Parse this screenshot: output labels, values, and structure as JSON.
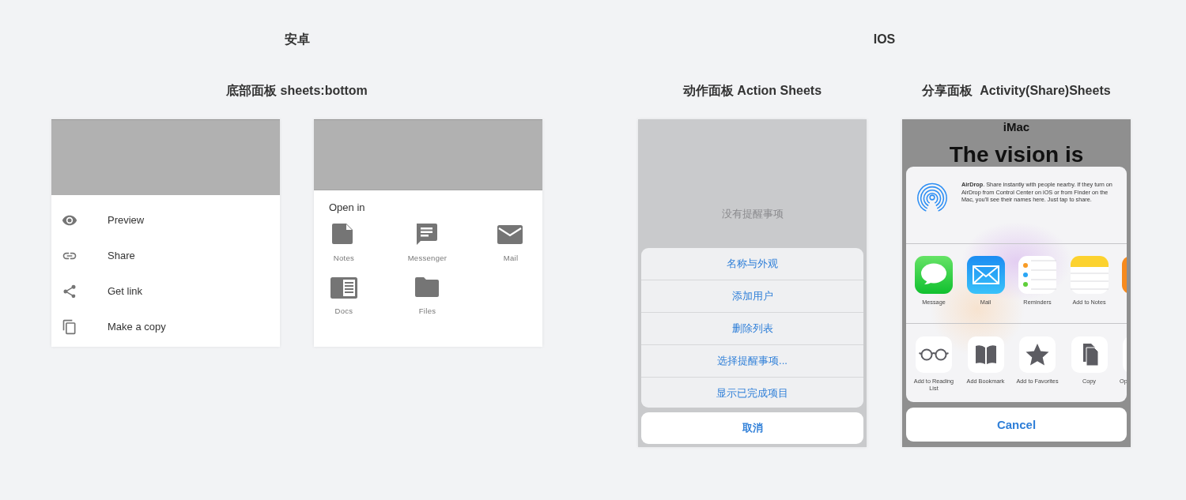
{
  "android": {
    "title": "安卓",
    "subtitle": "底部面板 sheets:bottom",
    "list_sheet": {
      "items": [
        {
          "label": "Preview"
        },
        {
          "label": "Share"
        },
        {
          "label": "Get link"
        },
        {
          "label": "Make a copy"
        }
      ]
    },
    "grid_sheet": {
      "heading": "Open in",
      "apps": [
        {
          "label": "Notes"
        },
        {
          "label": "Messenger"
        },
        {
          "label": "Mail"
        },
        {
          "label": "Docs"
        },
        {
          "label": "Files"
        }
      ]
    }
  },
  "ios": {
    "title": "IOS",
    "action_sheet": {
      "subtitle": "动作面板 Action Sheets",
      "empty_text": "没有提醒事项",
      "actions": [
        "名称与外观",
        "添加用户",
        "删除列表",
        "选择提醒事项...",
        "显示已完成项目"
      ],
      "cancel": "取消"
    },
    "share_sheet": {
      "subtitle": "分享面板  Activity(Share)Sheets",
      "backdrop_title": "iMac",
      "backdrop_heading": "The vision is",
      "airdrop_text": "**AirDrop**. Share instantly with people nearby. If they turn on AirDrop from Control Center on iOS or from Finder on the Mac, you'll see their names here. Just tap to share.",
      "apps": [
        {
          "label": "Message"
        },
        {
          "label": "Mail"
        },
        {
          "label": "Reminders"
        },
        {
          "label": "Add to Notes"
        }
      ],
      "actions": [
        {
          "label": "Add to Reading List"
        },
        {
          "label": "Add Bookmark"
        },
        {
          "label": "Add to Favorites"
        },
        {
          "label": "Copy"
        },
        {
          "label": "Op"
        }
      ],
      "cancel": "Cancel"
    }
  }
}
